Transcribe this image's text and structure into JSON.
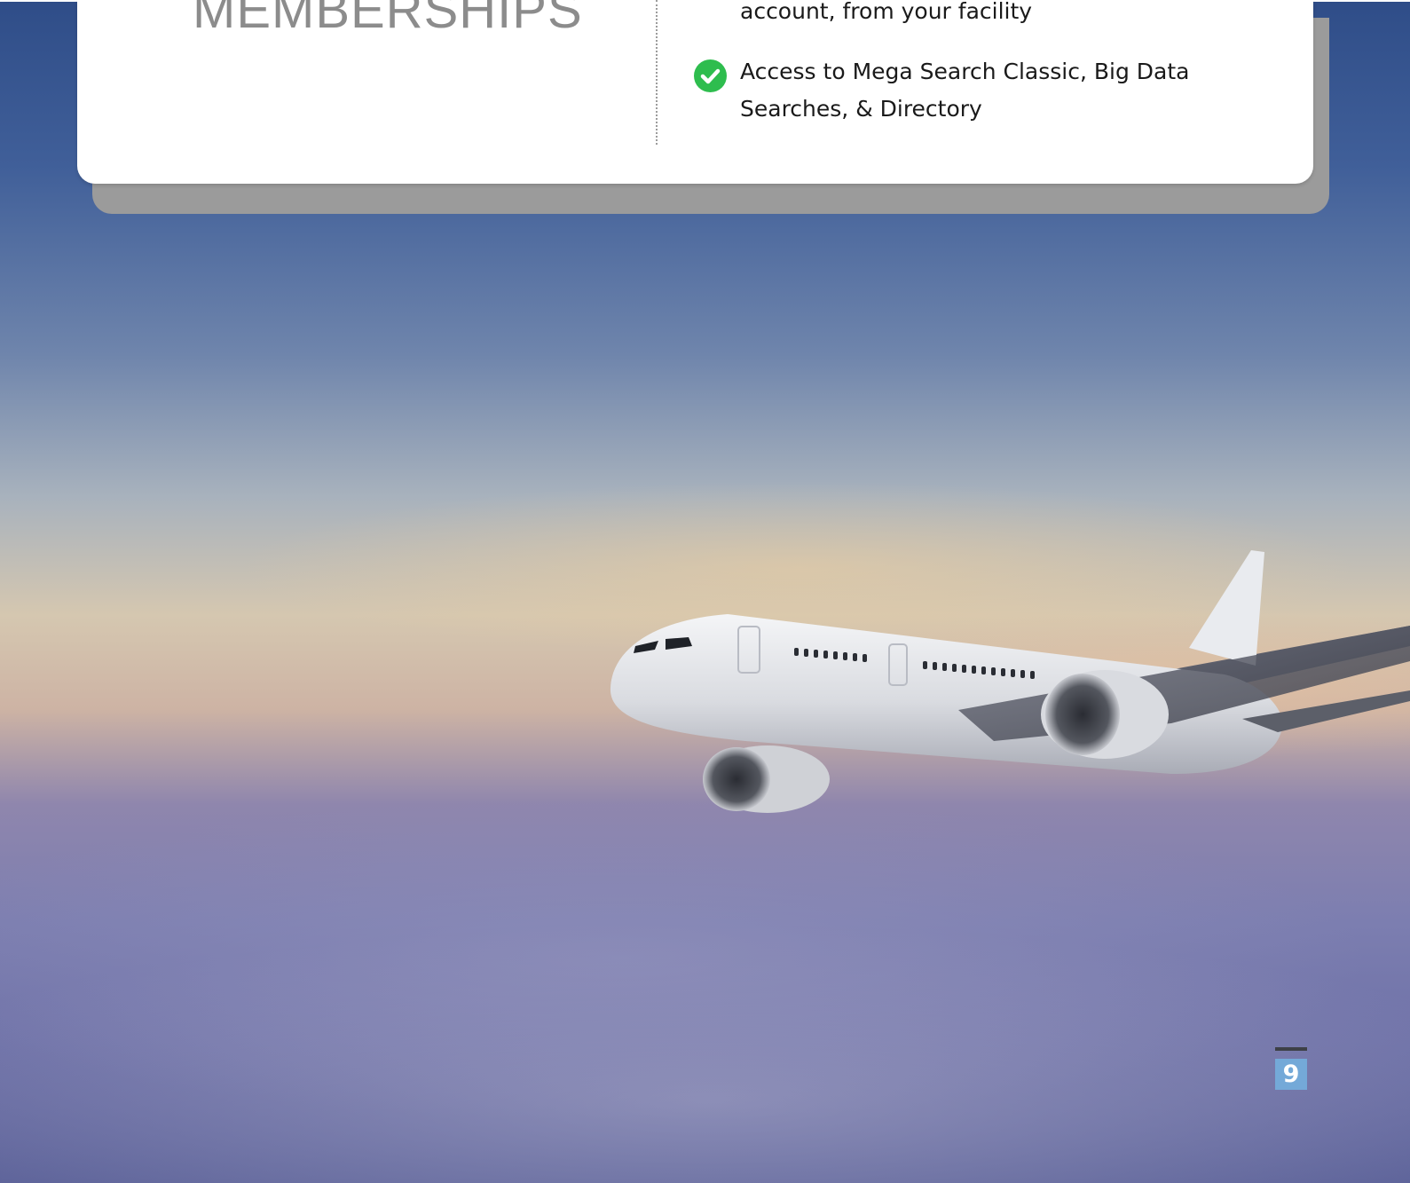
{
  "header": {
    "title": "MEMBERSHIPS"
  },
  "features": [
    {
      "icon": "check-circle-icon",
      "text": "account, from your facility"
    },
    {
      "icon": "check-circle-icon",
      "text": "Access to Mega Search Classic, Big Data Searches, & Directory"
    }
  ],
  "background": {
    "image": "airplane-above-clouds"
  },
  "footer": {
    "page_number": "9"
  },
  "colors": {
    "check": "#2ebd4e",
    "page_number_bg": "#74a9d8",
    "title": "#8c8c8c"
  }
}
